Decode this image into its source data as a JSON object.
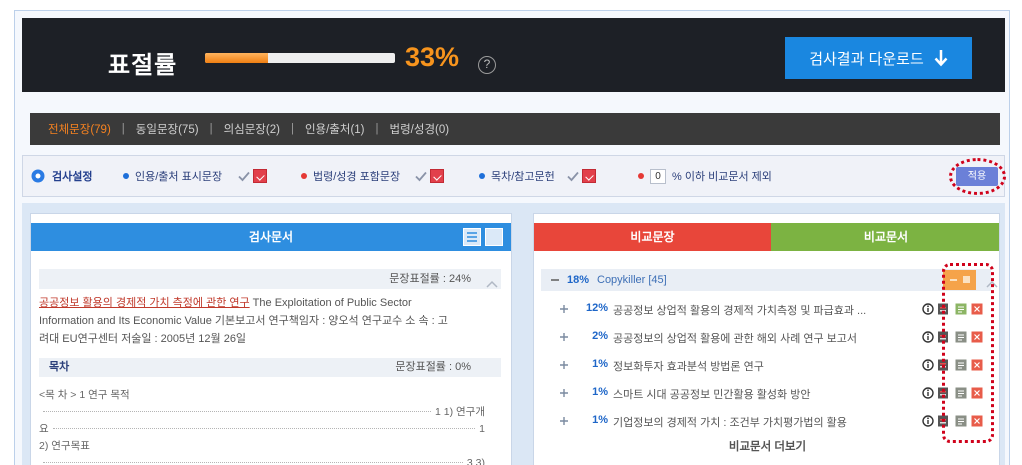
{
  "header": {
    "rate_label": "표절률",
    "rate_value": "33%",
    "progress": 0.33,
    "help_glyph": "?",
    "help_icon": "question-circle-icon",
    "download_label": "검사결과 다운로드",
    "download_icon": "arrow-down-icon"
  },
  "tabs": [
    {
      "label": "전체문장(79)",
      "active": true
    },
    {
      "label": "동일문장(75)",
      "active": false
    },
    {
      "label": "의심문장(2)",
      "active": false
    },
    {
      "label": "인용/출처(1)",
      "active": false
    },
    {
      "label": "법령/성경(0)",
      "active": false
    }
  ],
  "tab_separator": "|",
  "settings": {
    "title": "검사설정",
    "options": [
      {
        "label": "인용/출처 표시문장"
      },
      {
        "label": "법령/성경 포함문장"
      },
      {
        "label": "목차/참고문헌"
      }
    ],
    "threshold_value": "0",
    "threshold_label": "% 이하 비교문서 제외",
    "apply_label": "적용"
  },
  "document_panel": {
    "title": "검사문서",
    "rate_label": "문장표절률 : 24%",
    "lines": [
      {
        "highlight": "공공정보 활용의 경제적 가치 측정에 관한 연구",
        "text": " The Exploitation of Public Sector"
      },
      {
        "highlight": "",
        "text": "Information and Its Economic Value 기본보고서 연구책임자 : 양오석 연구교수 소 속 : 고"
      },
      {
        "highlight": "",
        "text": "려대 EU연구센터 저술일 : 2005년 12월 26일"
      }
    ],
    "toc_title": "목차",
    "toc_rate_label": "문장표절률 : 0%",
    "toc": [
      {
        "left": "<목 차 > 1 연구 목적",
        "right": ""
      },
      {
        "left": "",
        "right": "1 1) 연구개"
      },
      {
        "left": "요",
        "right": "1"
      },
      {
        "left": "2) 연구목표",
        "right": ""
      },
      {
        "left": "",
        "right": "3 3)"
      }
    ]
  },
  "compare_panel": {
    "tabs": [
      "비교문장",
      "비교문서"
    ],
    "group": {
      "rate": "18%",
      "name": "Copykiller [45]"
    },
    "items": [
      {
        "rate": "12%",
        "title": "공공정보 상업적 활용의 경제적 가치측정 및 파급효과 ..."
      },
      {
        "rate": "2%",
        "title": "공공정보의 상업적 활용에 관한 해외 사례 연구 보고서"
      },
      {
        "rate": "1%",
        "title": "정보화투자 효과분석 방법론 연구"
      },
      {
        "rate": "1%",
        "title": "스마트 시대 공공정보 민간활용 활성화 방안"
      },
      {
        "rate": "1%",
        "title": "기업정보의 경제적 가치 : 조건부 가치평가법의 활용"
      }
    ],
    "more_label": "비교문서 더보기"
  },
  "colors": {
    "accent": "#f58220",
    "primary": "#1a87e0",
    "compare_sentence_tab": "#e8463a",
    "compare_document_tab": "#7cb342",
    "annotation": "#d0021b"
  }
}
